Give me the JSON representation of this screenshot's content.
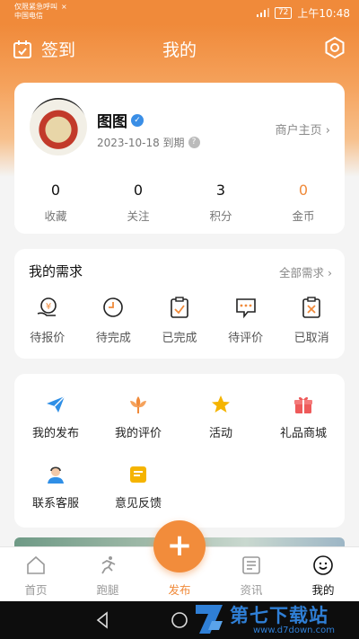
{
  "status_bar": {
    "line1": "仅限紧急呼叫",
    "carrier": "中国电信",
    "battery": "72",
    "time": "上午10:48"
  },
  "header": {
    "checkin_label": "签到",
    "title": "我的"
  },
  "profile": {
    "name": "图图",
    "expiry": "2023-10-18 到期",
    "merchant_link": "商户主页",
    "stats": [
      {
        "value": "0",
        "label": "收藏"
      },
      {
        "value": "0",
        "label": "关注"
      },
      {
        "value": "3",
        "label": "积分"
      },
      {
        "value": "0",
        "label": "金币"
      }
    ]
  },
  "needs": {
    "title": "我的需求",
    "all_link": "全部需求",
    "items": [
      {
        "label": "待报价",
        "icon": "yen-coin-icon"
      },
      {
        "label": "待完成",
        "icon": "clock-icon"
      },
      {
        "label": "已完成",
        "icon": "clipboard-check-icon"
      },
      {
        "label": "待评价",
        "icon": "chat-bubble-icon"
      },
      {
        "label": "已取消",
        "icon": "clipboard-x-icon"
      }
    ]
  },
  "tools": {
    "items": [
      {
        "label": "我的发布",
        "icon": "paper-plane-icon"
      },
      {
        "label": "我的评价",
        "icon": "flower-icon"
      },
      {
        "label": "活动",
        "icon": "star-icon"
      },
      {
        "label": "礼品商城",
        "icon": "gift-icon"
      },
      {
        "label": "联系客服",
        "icon": "service-agent-icon"
      },
      {
        "label": "意见反馈",
        "icon": "feedback-icon"
      }
    ]
  },
  "tabbar": {
    "items": [
      {
        "label": "首页",
        "icon": "home-icon"
      },
      {
        "label": "跑腿",
        "icon": "runner-icon"
      },
      {
        "label": "发布",
        "icon": "plus-icon"
      },
      {
        "label": "资讯",
        "icon": "news-icon"
      },
      {
        "label": "我的",
        "icon": "smiley-icon"
      }
    ],
    "active": "我的"
  },
  "watermark": {
    "text": "第七下载站",
    "url": "www.d7down.com"
  },
  "colors": {
    "accent": "#f08a3a",
    "blue": "#2f8fe6"
  }
}
